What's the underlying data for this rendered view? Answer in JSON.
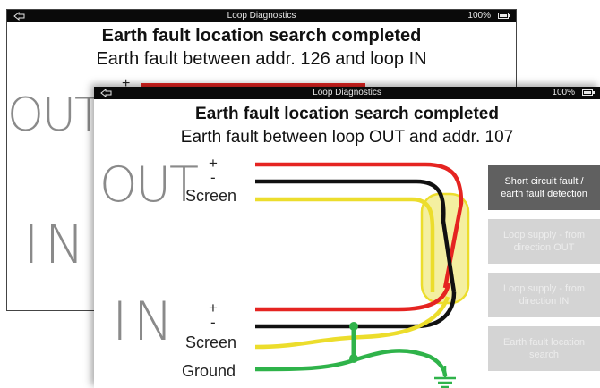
{
  "colors": {
    "wire_plus": "#e52421",
    "wire_minus": "#111111",
    "wire_screen": "#ecdd2c",
    "wire_ground": "#2fb34a",
    "button_active": "#606060",
    "button_disabled": "#d4d4d4"
  },
  "back_screen": {
    "status_title": "Loop Diagnostics",
    "battery": "100%",
    "heading": "Earth fault location search completed",
    "subheading": "Earth fault between addr. 126 and loop IN",
    "out_label": "OUT",
    "in_label": "IN",
    "plus_label": "+"
  },
  "front_screen": {
    "status_title": "Loop Diagnostics",
    "battery": "100%",
    "heading": "Earth fault location search completed",
    "subheading": "Earth fault between loop OUT and addr. 107",
    "out_label": "OUT",
    "in_label": "IN",
    "out_plus": "+",
    "out_minus": "-",
    "out_screen": "Screen",
    "in_plus": "+",
    "in_minus": "-",
    "in_screen": "Screen",
    "ground": "Ground",
    "buttons": [
      {
        "label": "Short circuit fault / earth fault detection",
        "state": "active"
      },
      {
        "label": "Loop supply - from direction OUT",
        "state": "disabled"
      },
      {
        "label": "Loop supply - from direction IN",
        "state": "disabled"
      },
      {
        "label": "Earth fault location search",
        "state": "disabled"
      }
    ]
  }
}
